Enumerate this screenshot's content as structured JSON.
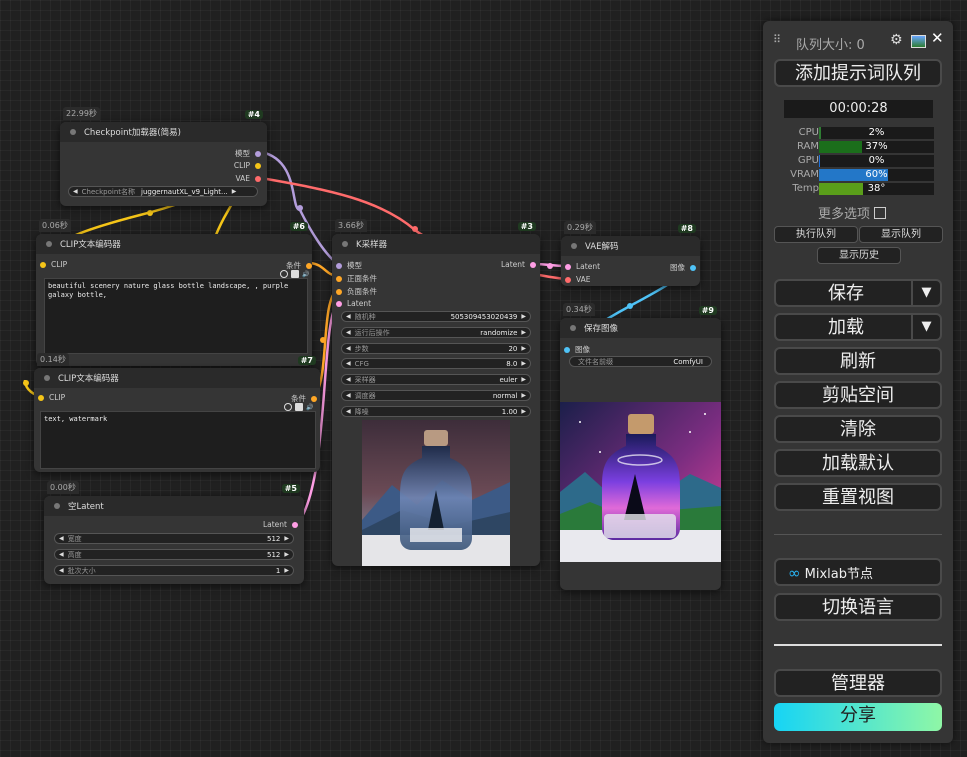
{
  "nodes": {
    "checkpoint": {
      "time": "22.99秒",
      "id": "#4",
      "title": "Checkpoint加载器(简易)",
      "outputs": [
        "模型",
        "CLIP",
        "VAE"
      ],
      "widget": {
        "label": "Checkpoint名称",
        "value": "juggernautXL_v9_Light..."
      }
    },
    "clip1": {
      "time": "0.06秒",
      "id": "#6",
      "title": "CLIP文本编码器",
      "input": "CLIP",
      "output": "条件",
      "text": "beautiful scenery nature glass bottle landscape, , purple galaxy bottle,"
    },
    "clip2": {
      "time": "0.14秒",
      "id": "#7",
      "title": "CLIP文本编码器",
      "input": "CLIP",
      "output": "条件",
      "text": "text, watermark"
    },
    "latent": {
      "time": "0.00秒",
      "id": "#5",
      "title": "空Latent",
      "output": "Latent",
      "widgets": [
        {
          "label": "宽度",
          "value": "512"
        },
        {
          "label": "高度",
          "value": "512"
        },
        {
          "label": "批次大小",
          "value": "1"
        }
      ]
    },
    "ksampler": {
      "time": "3.66秒",
      "id": "#3",
      "title": "K采样器",
      "inputs": [
        "模型",
        "正面条件",
        "负面条件",
        "Latent"
      ],
      "output": "Latent",
      "widgets": [
        {
          "label": "随机种",
          "value": "505309453020439"
        },
        {
          "label": "运行后操作",
          "value": "randomize"
        },
        {
          "label": "步数",
          "value": "20"
        },
        {
          "label": "CFG",
          "value": "8.0"
        },
        {
          "label": "采样器",
          "value": "euler"
        },
        {
          "label": "调度器",
          "value": "normal"
        },
        {
          "label": "降噪",
          "value": "1.00"
        }
      ]
    },
    "vae": {
      "time": "0.29秒",
      "id": "#8",
      "title": "VAE解码",
      "inputs": [
        "Latent",
        "VAE"
      ],
      "output": "图像"
    },
    "save": {
      "time": "0.34秒",
      "id": "#9",
      "title": "保存图像",
      "input": "图像",
      "widget": {
        "label": "文件名前缀",
        "value": "ComfyUI"
      }
    }
  },
  "panel": {
    "queue_title": "队列大小: 0",
    "queue_prompt": "添加提示词队列",
    "timer": "00:00:28",
    "stats": [
      {
        "label": "CPU",
        "value": "2%",
        "level": 2,
        "color": "#2e7d32"
      },
      {
        "label": "RAM",
        "value": "37%",
        "level": 37,
        "color": "#1b6e1b"
      },
      {
        "label": "GPU",
        "value": "0%",
        "level": 0,
        "color": "#1e6fd9"
      },
      {
        "label": "VRAM",
        "value": "60%",
        "level": 60,
        "color": "#2377c8"
      },
      {
        "label": "Temp",
        "value": "38°",
        "level": 38,
        "color": "#5a9e1a"
      }
    ],
    "more_options": "更多选项",
    "run_queue": "执行队列",
    "show_queue": "显示队列",
    "show_history": "显示历史",
    "save": "保存",
    "load": "加载",
    "refresh": "刷新",
    "clipspace": "剪贴空间",
    "clear": "清除",
    "load_default": "加载默认",
    "reset_view": "重置视图",
    "mixlab": "Mixlab节点",
    "switch_lang": "切换语言",
    "manager": "管理器",
    "share": "分享",
    "colors": {
      "share_start": "#16d4f5",
      "share_end": "#8ff7a6"
    }
  }
}
